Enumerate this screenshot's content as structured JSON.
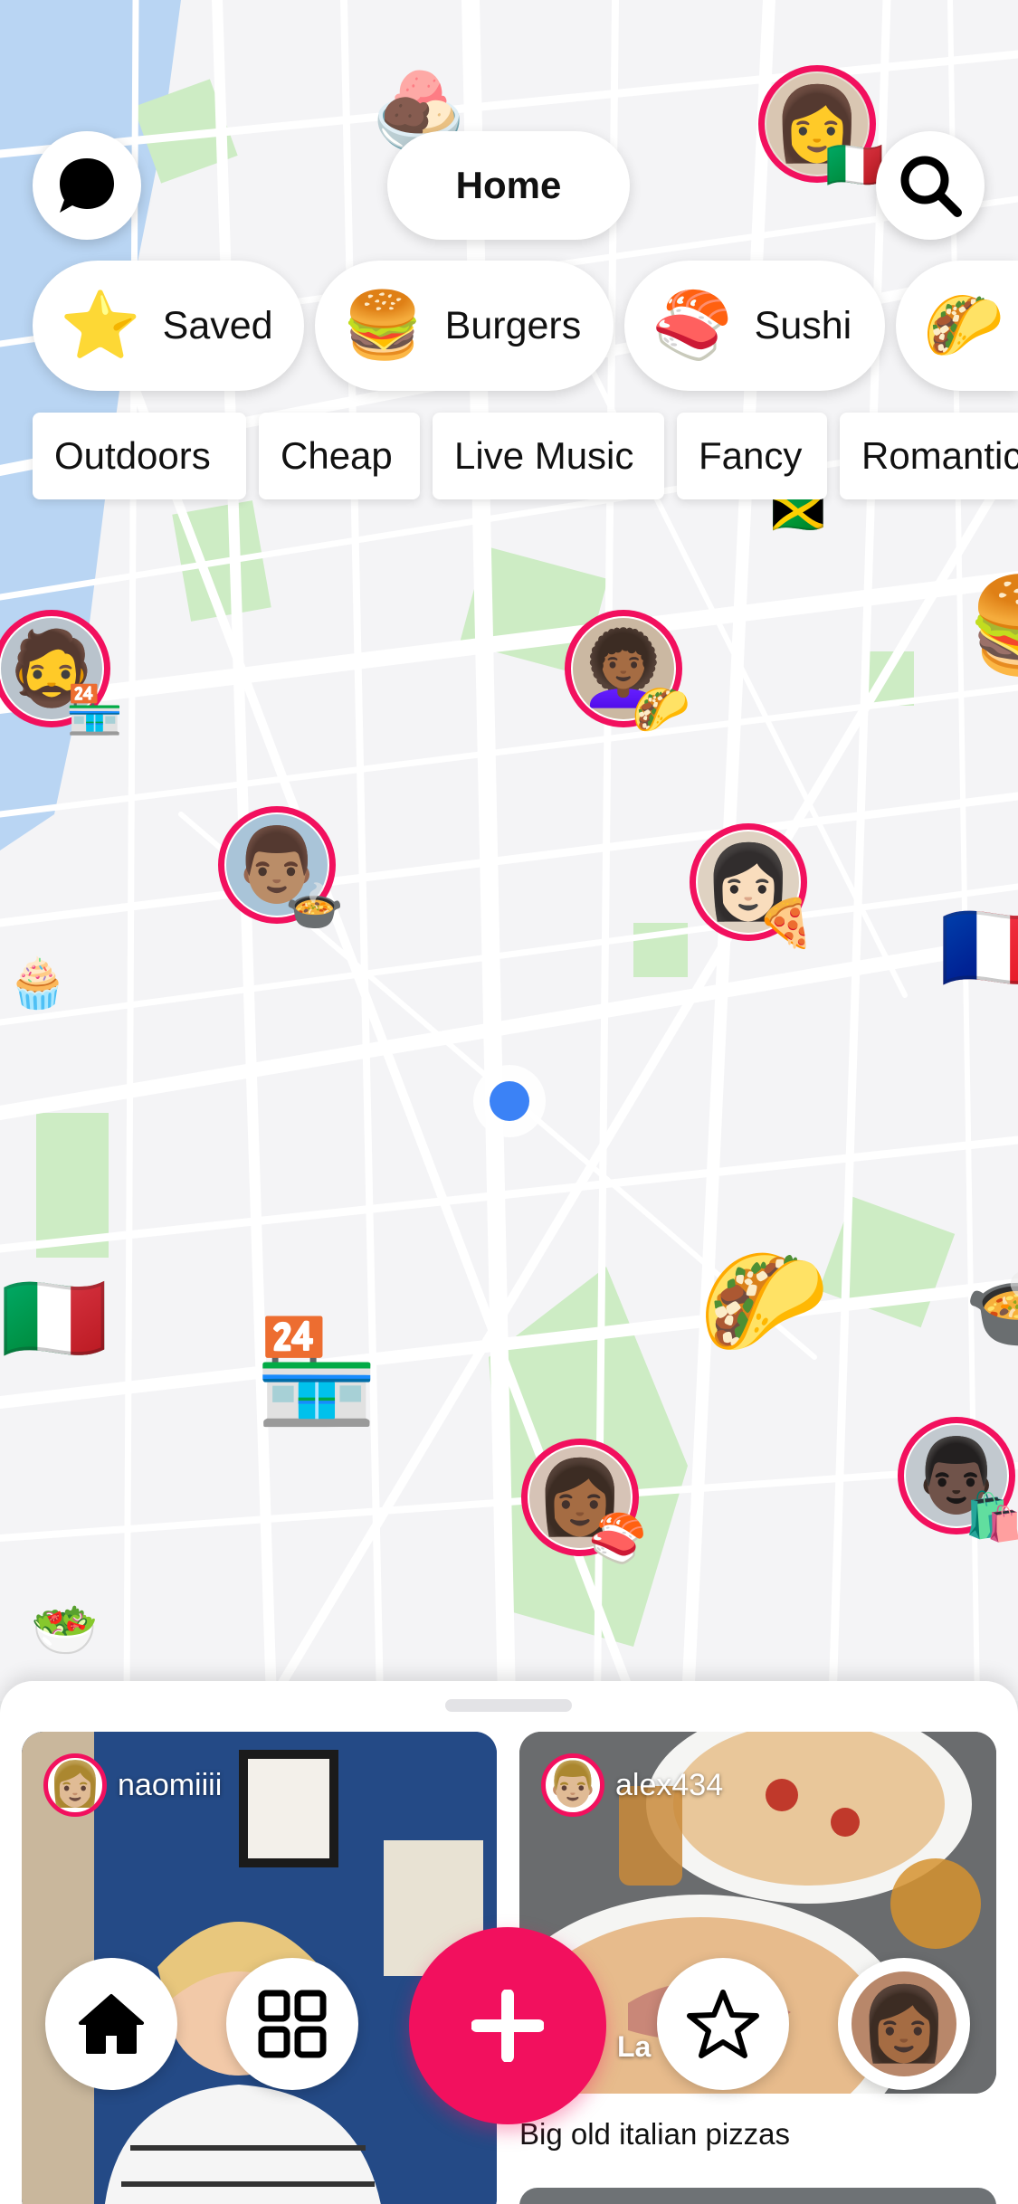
{
  "top": {
    "title": "Home",
    "chat_icon": "chat-bubble-icon",
    "search_icon": "search-icon"
  },
  "categories": [
    {
      "emoji": "⭐",
      "label": "Saved"
    },
    {
      "emoji": "🍔",
      "label": "Burgers"
    },
    {
      "emoji": "🍣",
      "label": "Sushi"
    },
    {
      "emoji": "🌮",
      "label": ""
    }
  ],
  "filters": [
    "Outdoors",
    "Cheap",
    "Live Music",
    "Fancy",
    "Romantic"
  ],
  "map": {
    "markers": [
      {
        "face": "👩",
        "badge": "🇮🇹"
      },
      {
        "face": "🧔",
        "badge": "🏪"
      },
      {
        "face": "👩🏾‍🦱",
        "badge": "🌮"
      },
      {
        "face": "👨🏽",
        "badge": "🍲"
      },
      {
        "face": "👩🏻",
        "badge": "🍕"
      },
      {
        "face": "👩🏾",
        "badge": "🍣"
      },
      {
        "face": "👨🏿",
        "badge": "🛍️"
      }
    ],
    "emoji_markers": [
      "🍨",
      "🇯🇲",
      "🍔",
      "🧁",
      "🇫🇷",
      "🇮🇹",
      "🏪",
      "🌮",
      "🍲",
      "🥗"
    ]
  },
  "feed": [
    {
      "username": "naomiiii",
      "caption": "",
      "avatar": "👩🏼"
    },
    {
      "username": "alex434",
      "caption": "Big old italian pizzas",
      "overlay": "La",
      "avatar": "👨🏼"
    }
  ],
  "nav": {
    "home_icon": "home-icon",
    "grid_icon": "grid-icon",
    "add_icon": "plus-icon",
    "star_icon": "star-icon",
    "profile_avatar": "👩🏾"
  },
  "colors": {
    "accent": "#f2105e",
    "location": "#3b82f6",
    "park": "#c8ecc0",
    "water": "#b5d3f3"
  }
}
